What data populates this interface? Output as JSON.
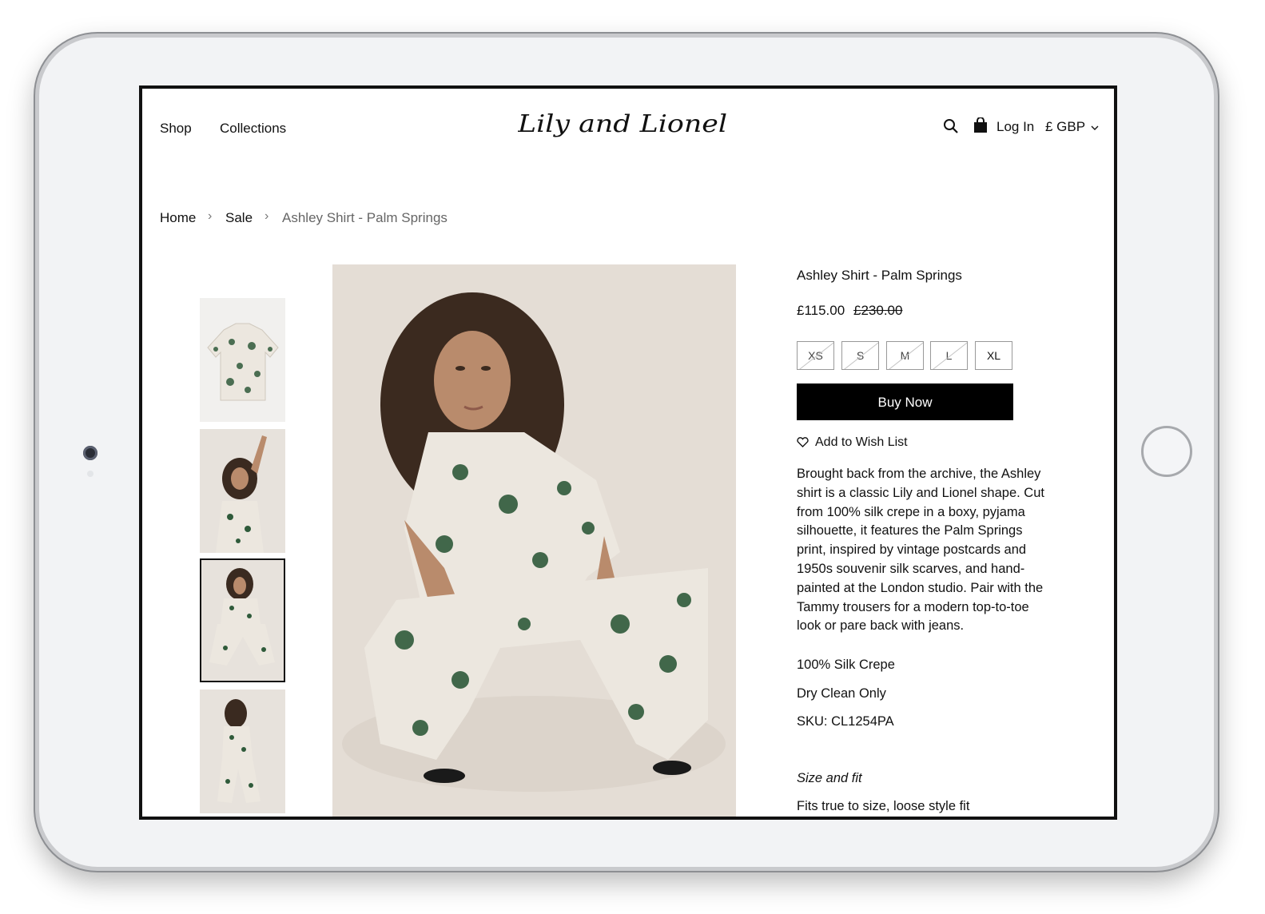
{
  "header": {
    "nav": [
      "Shop",
      "Collections"
    ],
    "logo_text": "Lily and Lionel",
    "login_label": "Log In",
    "currency_label": "£ GBP"
  },
  "breadcrumb": [
    "Home",
    "Sale",
    "Ashley Shirt - Palm Springs"
  ],
  "gallery": {
    "thumbnail_count": 4,
    "selected_index": 2
  },
  "product": {
    "title": "Ashley Shirt - Palm Springs",
    "price": "£115.00",
    "original_price": "£230.00",
    "sizes": [
      {
        "label": "XS",
        "available": false
      },
      {
        "label": "S",
        "available": false
      },
      {
        "label": "M",
        "available": false
      },
      {
        "label": "L",
        "available": false
      },
      {
        "label": "XL",
        "available": true
      }
    ],
    "buy_label": "Buy Now",
    "wishlist_label": "Add to Wish List",
    "description": "Brought back from the archive, the Ashley shirt is a classic Lily and Lionel shape. Cut from 100% silk crepe in a boxy, pyjama silhouette, it features the Palm Springs print, inspired by vintage postcards and 1950s souvenir silk scarves, and hand-painted at the London studio. Pair with the Tammy trousers for a modern top-to-toe look or pare back with jeans.",
    "material": "100% Silk Crepe",
    "care": "Dry Clean Only",
    "sku": "SKU: CL1254PA",
    "size_fit_heading": "Size and fit",
    "size_fit_text": "Fits true to size, loose style fit"
  },
  "colors": {
    "accent": "#000000",
    "photo_background": "#e4ddd5",
    "print_green": "#2f5a3a"
  }
}
